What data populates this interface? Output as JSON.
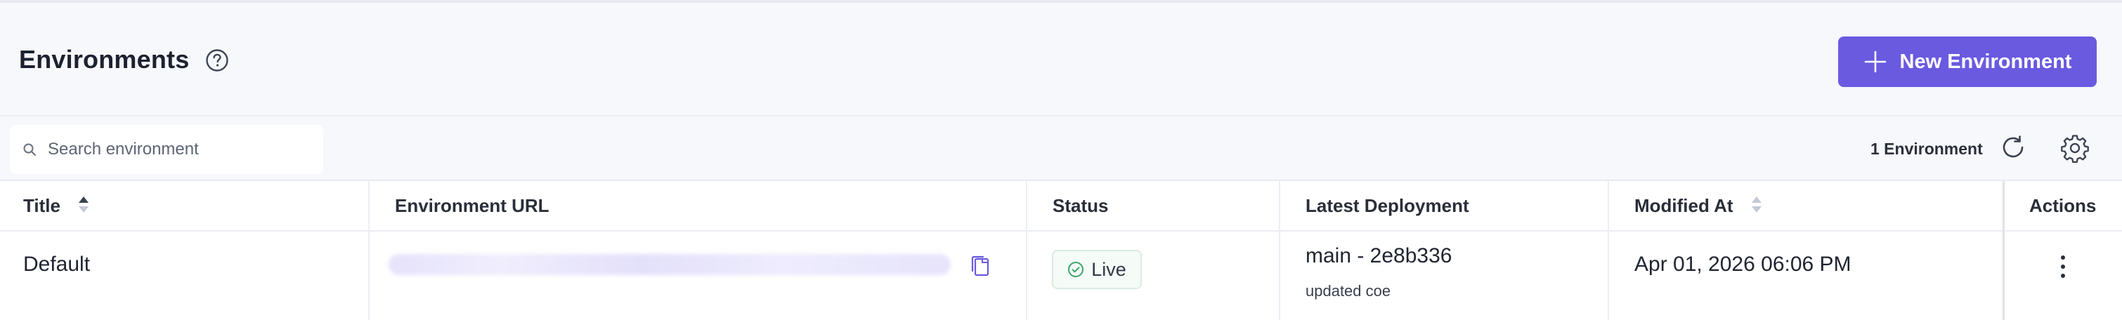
{
  "header": {
    "title": "Environments",
    "new_button_label": "New Environment"
  },
  "toolbar": {
    "search_placeholder": "Search environment",
    "env_count": "1 Environment"
  },
  "table": {
    "columns": [
      "Title",
      "Environment URL",
      "Status",
      "Latest Deployment",
      "Modified At",
      "Actions"
    ],
    "rows": [
      {
        "title": "Default",
        "status": "Live",
        "deployment": "main - 2e8b336",
        "deployment_note": "updated coe",
        "modified_at": "Apr 01, 2026 06:06 PM"
      }
    ]
  },
  "colors": {
    "accent": "#6a5ae0",
    "status_live": "#3aa66a",
    "background": "#f7f8fc"
  },
  "icons": {
    "help": "help-circle-icon",
    "add": "plus-icon",
    "search": "search-icon",
    "refresh": "refresh-icon",
    "settings": "gear-icon",
    "copy": "copy-icon",
    "status": "check-circle-icon",
    "actions": "kebab-menu-icon"
  }
}
